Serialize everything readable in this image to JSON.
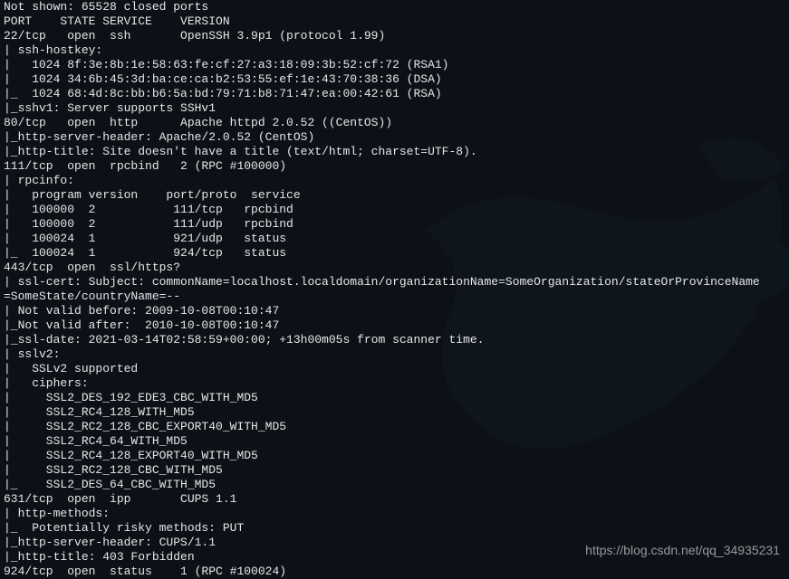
{
  "terminal_lines": [
    "Not shown: 65528 closed ports",
    "PORT    STATE SERVICE    VERSION",
    "22/tcp   open  ssh       OpenSSH 3.9p1 (protocol 1.99)",
    "| ssh-hostkey:",
    "|   1024 8f:3e:8b:1e:58:63:fe:cf:27:a3:18:09:3b:52:cf:72 (RSA1)",
    "|   1024 34:6b:45:3d:ba:ce:ca:b2:53:55:ef:1e:43:70:38:36 (DSA)",
    "|_  1024 68:4d:8c:bb:b6:5a:bd:79:71:b8:71:47:ea:00:42:61 (RSA)",
    "|_sshv1: Server supports SSHv1",
    "80/tcp   open  http      Apache httpd 2.0.52 ((CentOS))",
    "|_http-server-header: Apache/2.0.52 (CentOS)",
    "|_http-title: Site doesn't have a title (text/html; charset=UTF-8).",
    "111/tcp  open  rpcbind   2 (RPC #100000)",
    "| rpcinfo:",
    "|   program version    port/proto  service",
    "|   100000  2           111/tcp   rpcbind",
    "|   100000  2           111/udp   rpcbind",
    "|   100024  1           921/udp   status",
    "|_  100024  1           924/tcp   status",
    "443/tcp  open  ssl/https?",
    "| ssl-cert: Subject: commonName=localhost.localdomain/organizationName=SomeOrganization/stateOrProvinceName",
    "=SomeState/countryName=--",
    "| Not valid before: 2009-10-08T00:10:47",
    "|_Not valid after:  2010-10-08T00:10:47",
    "|_ssl-date: 2021-03-14T02:58:59+00:00; +13h00m05s from scanner time.",
    "| sslv2:",
    "|   SSLv2 supported",
    "|   ciphers:",
    "|     SSL2_DES_192_EDE3_CBC_WITH_MD5",
    "|     SSL2_RC4_128_WITH_MD5",
    "|     SSL2_RC2_128_CBC_EXPORT40_WITH_MD5",
    "|     SSL2_RC4_64_WITH_MD5",
    "|     SSL2_RC4_128_EXPORT40_WITH_MD5",
    "|     SSL2_RC2_128_CBC_WITH_MD5",
    "|_    SSL2_DES_64_CBC_WITH_MD5",
    "631/tcp  open  ipp       CUPS 1.1",
    "| http-methods:",
    "|_  Potentially risky methods: PUT",
    "|_http-server-header: CUPS/1.1",
    "|_http-title: 403 Forbidden",
    "924/tcp  open  status    1 (RPC #100024)"
  ],
  "watermark": "https://blog.csdn.net/qq_34935231"
}
